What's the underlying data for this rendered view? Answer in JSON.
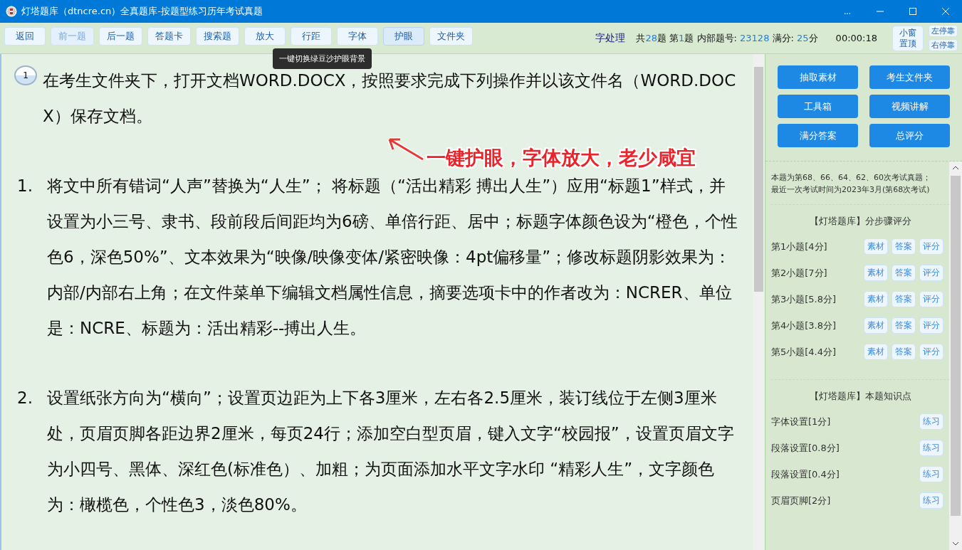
{
  "window": {
    "title": "灯塔题库（dtncre.cn）全真题库-按题型练习历年考试真题",
    "more": "..."
  },
  "toolbar": [
    {
      "label": "返回",
      "disabled": false,
      "selected": false
    },
    {
      "label": "前一题",
      "disabled": true,
      "selected": false
    },
    {
      "label": "后一题",
      "disabled": false,
      "selected": false
    },
    {
      "label": "答题卡",
      "disabled": false,
      "selected": false
    },
    {
      "label": "搜索题",
      "disabled": false,
      "selected": false
    },
    {
      "label": "放大",
      "disabled": false,
      "selected": false
    },
    {
      "label": "行距",
      "disabled": false,
      "selected": false
    },
    {
      "label": "字体",
      "disabled": false,
      "selected": false
    },
    {
      "label": "护眼",
      "disabled": false,
      "selected": true
    },
    {
      "label": "文件夹",
      "disabled": false,
      "selected": false
    }
  ],
  "tooltip": "一键切换绿豆沙护眼背景",
  "info": {
    "category": "字处理",
    "stats": [
      {
        "label": "共",
        "value": "28",
        "unit": "题"
      },
      {
        "label": "第",
        "value": "1",
        "unit": "题"
      },
      {
        "label": "内部题号: ",
        "value": "23128"
      },
      {
        "label": "满分: ",
        "value": "25",
        "unit": "分"
      }
    ],
    "timer": "00:00:18",
    "pin_button": [
      "小窗",
      "置顶"
    ],
    "dock_buttons": [
      "左停靠",
      "右停靠"
    ]
  },
  "question": {
    "number": "1",
    "intro": "在考生文件夹下，打开文档WORD.DOCX，按照要求完成下列操作并以该文件名（WORD.DOCX）保存文档。",
    "items": [
      {
        "marker": "1.",
        "text": "将文中所有错词“人声”替换为“人生”； 将标题（“活出精彩 搏出人生”）应用“标题1”样式，并设置为小三号、隶书、段前段后间距均为6磅、单倍行距、居中；标题字体颜色设为“橙色，个性色6，深色50%”、文本效果为“映像/映像变体/紧密映像：4pt偏移量”；修改标题阴影效果为：内部/内部右上角；在文件菜单下编辑文档属性信息，摘要选项卡中的作者改为：NCRER、单位是：NCRE、标题为：活出精彩--搏出人生。"
      },
      {
        "marker": "2.",
        "text": "设置纸张方向为“横向”；设置页边距为上下各3厘米，左右各2.5厘米，装订线位于左侧3厘米处，页眉页脚各距边界2厘米，每页24行；添加空白型页眉，键入文字“校园报”，设置页眉文字为小四号、黑体、深红色(标准色）、加粗；为页面添加水平文字水印 “精彩人生”，文字颜色为：橄榄色，个性色3，淡色80%。"
      }
    ]
  },
  "annotation": "一键护眼，字体放大，老少咸宜",
  "side": {
    "actions": [
      "抽取素材",
      "考生文件夹",
      "工具箱",
      "视频讲解",
      "满分答案",
      "总评分"
    ],
    "exam_note": [
      "本题为第68、66、64、62、60次考试真题；",
      "最近一次考试时间为2023年3月(第68次考试)"
    ],
    "steps_title": "【灯塔题库】分步骤评分",
    "steps": [
      {
        "label": "第1小题[4分]",
        "buttons": [
          "素材",
          "答案",
          "评分"
        ]
      },
      {
        "label": "第2小题[7分]",
        "buttons": [
          "素材",
          "答案",
          "评分"
        ]
      },
      {
        "label": "第3小题[5.8分]",
        "buttons": [
          "素材",
          "答案",
          "评分"
        ]
      },
      {
        "label": "第4小题[3.8分]",
        "buttons": [
          "素材",
          "答案",
          "评分"
        ]
      },
      {
        "label": "第5小题[4.4分]",
        "buttons": [
          "素材",
          "答案",
          "评分"
        ]
      }
    ],
    "points_title": "【灯塔题库】本题知识点",
    "points": [
      {
        "label": "字体设置[1分]",
        "button": "练习"
      },
      {
        "label": "段落设置[0.8分]",
        "button": "练习"
      },
      {
        "label": "段落设置[0.4分]",
        "button": "练习"
      },
      {
        "label": "页眉页脚[2分]",
        "button": "练习"
      }
    ]
  }
}
